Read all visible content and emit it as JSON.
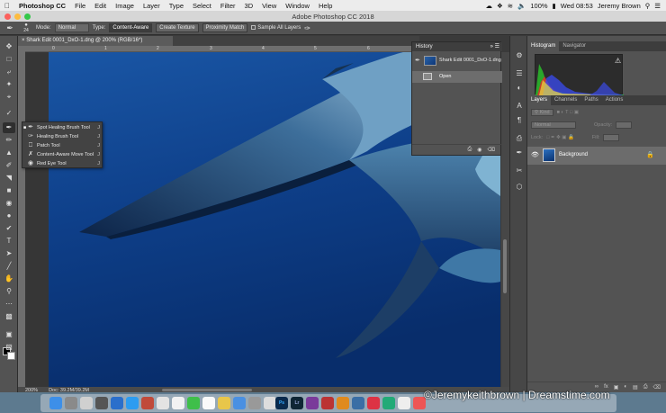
{
  "menubar": {
    "app_name": "Photoshop CC",
    "items": [
      "File",
      "Edit",
      "Image",
      "Layer",
      "Type",
      "Select",
      "Filter",
      "3D",
      "View",
      "Window",
      "Help"
    ],
    "battery": "100%",
    "clock": "Wed 08:53",
    "user": "Jeremy Brown"
  },
  "window": {
    "title": "Adobe Photoshop CC 2018"
  },
  "options_bar": {
    "brush_size": "24",
    "mode_label": "Mode:",
    "mode_value": "Normal",
    "type_label": "Type:",
    "type_buttons": [
      "Content-Aware",
      "Create Texture",
      "Proximity Match"
    ],
    "sample_all_layers": "Sample All Layers"
  },
  "document": {
    "tab_title": "Shark Edit 0001_DxO-1.dng @ 200% (RGB/16*)",
    "ruler_marks": [
      "0",
      "1",
      "2",
      "3",
      "4",
      "5",
      "6",
      "7",
      "8",
      "9"
    ],
    "zoom": "200%",
    "doc_info": "Doc: 39.2M/39.2M"
  },
  "flyout": {
    "items": [
      {
        "label": "Spot Healing Brush Tool",
        "key": "J",
        "icon": "spot-healing-brush-icon"
      },
      {
        "label": "Healing Brush Tool",
        "key": "J",
        "icon": "healing-brush-icon"
      },
      {
        "label": "Patch Tool",
        "key": "J",
        "icon": "patch-icon"
      },
      {
        "label": "Content-Aware Move Tool",
        "key": "J",
        "icon": "content-aware-move-icon"
      },
      {
        "label": "Red Eye Tool",
        "key": "J",
        "icon": "red-eye-icon"
      }
    ]
  },
  "history": {
    "tab": "History",
    "snapshot": "Shark Edit 0001_DxO-1.dng",
    "states": [
      "Open"
    ]
  },
  "histogram_panel": {
    "tabs": [
      "Histogram",
      "Navigator"
    ]
  },
  "layers_panel": {
    "tabs": [
      "Layers",
      "Channels",
      "Paths",
      "Actions"
    ],
    "kind_label": "Kind",
    "blend_mode": "Normal",
    "opacity_label": "Opacity:",
    "lock_label": "Lock:",
    "fill_label": "Fill:",
    "layers": [
      {
        "name": "Background",
        "visible": true,
        "locked": true
      }
    ]
  },
  "watermark": "©Jeremykeithbrown | Dreamstime.com",
  "colors": {
    "panel": "#535353",
    "ocean_deep": "#0a3170",
    "ocean_light": "#1f5fb0"
  }
}
